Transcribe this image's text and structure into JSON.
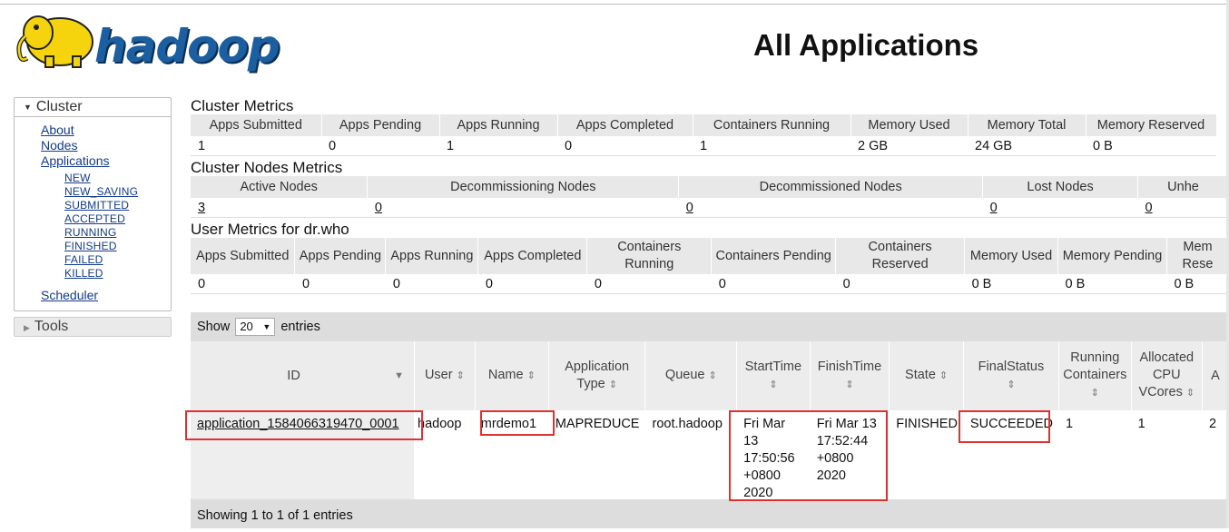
{
  "header": {
    "logo_text": "hadoop",
    "title": "All Applications"
  },
  "nav": {
    "cluster_label": "Cluster",
    "links": [
      "About",
      "Nodes",
      "Applications"
    ],
    "app_states": [
      "NEW",
      "NEW_SAVING",
      "SUBMITTED",
      "ACCEPTED",
      "RUNNING",
      "FINISHED",
      "FAILED",
      "KILLED"
    ],
    "scheduler": "Scheduler",
    "tools_label": "Tools"
  },
  "cluster_metrics": {
    "title": "Cluster Metrics",
    "headers": [
      "Apps Submitted",
      "Apps Pending",
      "Apps Running",
      "Apps Completed",
      "Containers Running",
      "Memory Used",
      "Memory Total",
      "Memory Reserved"
    ],
    "values": [
      "1",
      "0",
      "1",
      "0",
      "1",
      "2 GB",
      "24 GB",
      "0 B"
    ]
  },
  "nodes_metrics": {
    "title": "Cluster Nodes Metrics",
    "headers": [
      "Active Nodes",
      "Decommissioning Nodes",
      "Decommissioned Nodes",
      "Lost Nodes",
      "Unhe"
    ],
    "values": [
      "3",
      "0",
      "0",
      "0",
      "0"
    ]
  },
  "user_metrics": {
    "title": "User Metrics for dr.who",
    "headers": [
      "Apps Submitted",
      "Apps Pending",
      "Apps Running",
      "Apps Completed",
      "Containers Running",
      "Containers Pending",
      "Containers Reserved",
      "Memory Used",
      "Memory Pending",
      "Mem Rese"
    ],
    "values": [
      "0",
      "0",
      "0",
      "0",
      "0",
      "0",
      "0",
      "0 B",
      "0 B",
      "0 B"
    ]
  },
  "table": {
    "show_label": "Show",
    "page_size": "20",
    "entries_label": "entries",
    "columns": [
      "ID",
      "User",
      "Name",
      "Application Type",
      "Queue",
      "StartTime",
      "FinishTime",
      "State",
      "FinalStatus",
      "Running Containers",
      "Allocated CPU VCores",
      "A"
    ],
    "rows": [
      {
        "id": "application_1584066319470_0001",
        "user": "hadoop",
        "name": "mrdemo1",
        "type": "MAPREDUCE",
        "queue": "root.hadoop",
        "start": [
          "Fri Mar",
          "13",
          "17:50:56",
          "+0800",
          "2020"
        ],
        "finish": [
          "Fri Mar 13",
          "17:52:44",
          "+0800",
          "2020"
        ],
        "state": "FINISHED",
        "final": "SUCCEEDED",
        "running": "1",
        "vcores": "1",
        "extra": "2"
      }
    ],
    "footer": "Showing 1 to 1 of 1 entries"
  },
  "colors": {
    "highlight": "#e03030",
    "link": "#123a8a",
    "header_bg": "#e8e8e8"
  }
}
